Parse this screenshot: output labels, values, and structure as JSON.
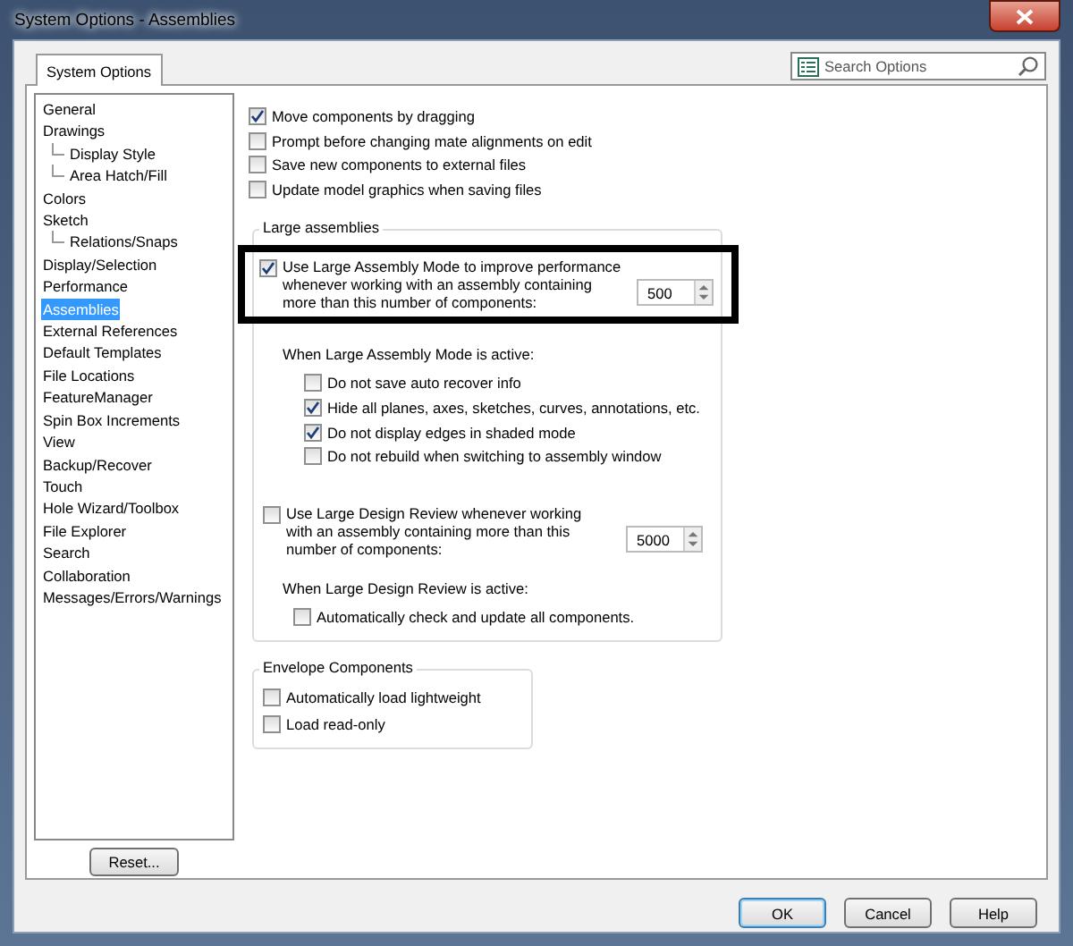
{
  "window": {
    "title": "System Options - Assemblies"
  },
  "tabs": [
    {
      "label": "System Options",
      "selected": true
    }
  ],
  "search": {
    "placeholder": "Search Options"
  },
  "sidebar": {
    "items": [
      {
        "label": "General",
        "selected": false
      },
      {
        "label": "Drawings",
        "selected": false,
        "children": [
          {
            "label": "Display Style",
            "selected": false
          },
          {
            "label": "Area Hatch/Fill",
            "selected": false
          }
        ]
      },
      {
        "label": "Colors",
        "selected": false
      },
      {
        "label": "Sketch",
        "selected": false,
        "children": [
          {
            "label": "Relations/Snaps",
            "selected": false
          }
        ]
      },
      {
        "label": "Display/Selection",
        "selected": false
      },
      {
        "label": "Performance",
        "selected": false
      },
      {
        "label": "Assemblies",
        "selected": true
      },
      {
        "label": "External References",
        "selected": false
      },
      {
        "label": "Default Templates",
        "selected": false
      },
      {
        "label": "File Locations",
        "selected": false
      },
      {
        "label": "FeatureManager",
        "selected": false
      },
      {
        "label": "Spin Box Increments",
        "selected": false
      },
      {
        "label": "View",
        "selected": false
      },
      {
        "label": "Backup/Recover",
        "selected": false
      },
      {
        "label": "Touch",
        "selected": false
      },
      {
        "label": "Hole Wizard/Toolbox",
        "selected": false
      },
      {
        "label": "File Explorer",
        "selected": false
      },
      {
        "label": "Search",
        "selected": false
      },
      {
        "label": "Collaboration",
        "selected": false
      },
      {
        "label": "Messages/Errors/Warnings",
        "selected": false
      }
    ]
  },
  "options": [
    {
      "label": "Move components by dragging",
      "checked": true
    },
    {
      "label": "Prompt before changing mate alignments on edit",
      "checked": false
    },
    {
      "label": "Save new components to external files",
      "checked": false
    },
    {
      "label": "Update model graphics when saving files",
      "checked": false
    }
  ],
  "large_assemblies": {
    "title": "Large assemblies",
    "mode": {
      "label": "Use Large Assembly Mode to improve performance whenever working with an assembly containing more than this number of components:",
      "checked": true,
      "value": "500",
      "highlighted": true
    },
    "mode_subtitle": "When Large Assembly Mode is active:",
    "mode_options": [
      {
        "label": "Do not save auto recover info",
        "checked": false
      },
      {
        "label": "Hide all planes, axes, sketches, curves, annotations, etc.",
        "checked": true
      },
      {
        "label": "Do not display edges in shaded mode",
        "checked": true
      },
      {
        "label": "Do not rebuild when switching to assembly window",
        "checked": false
      }
    ],
    "review": {
      "label": "Use Large Design Review whenever working with an assembly containing more than this number of components:",
      "checked": false,
      "value": "5000",
      "highlighted": false
    },
    "review_subtitle": "When Large Design Review is active:",
    "review_options": [
      {
        "label": "Automatically check and update all components.",
        "checked": false
      }
    ]
  },
  "envelope": {
    "title": "Envelope Components",
    "options": [
      {
        "label": "Automatically load lightweight",
        "checked": false
      },
      {
        "label": "Load read-only",
        "checked": false
      }
    ]
  },
  "reset_button": "Reset...",
  "buttons": [
    {
      "label": "OK",
      "default": true
    },
    {
      "label": "Cancel",
      "default": false
    },
    {
      "label": "Help",
      "default": false
    }
  ]
}
